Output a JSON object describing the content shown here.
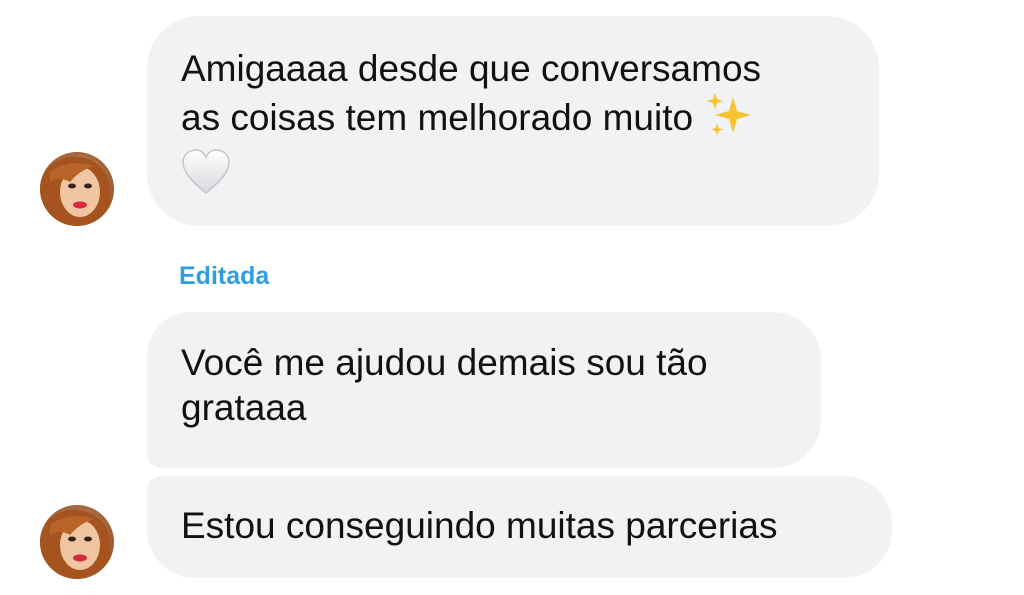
{
  "thread": {
    "messages": [
      {
        "lines": [
          "Amigaaaa desde que conversamos",
          "as coisas tem melhorado muito"
        ],
        "trailing_emoji": "sparkles-icon",
        "extra_emoji": "white-heart-icon"
      },
      {
        "lines": [
          "Você me ajudou demais sou tão",
          "grataaa"
        ],
        "edited_label": "Editada"
      },
      {
        "lines": [
          "Estou conseguindo muitas parcerias"
        ]
      }
    ],
    "bubble_color": "#f1f2f4",
    "edited_color": "#2e9ee0"
  }
}
